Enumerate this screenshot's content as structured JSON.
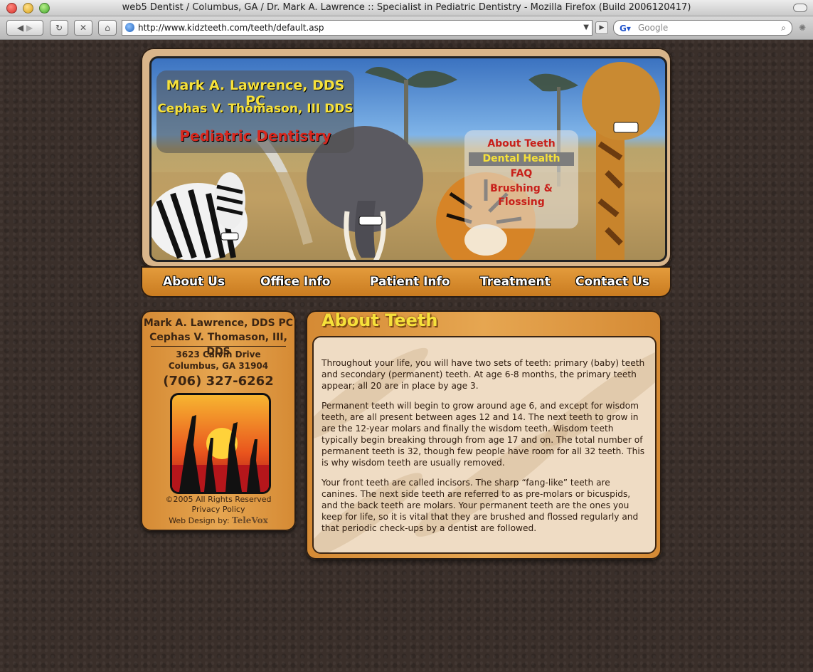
{
  "browser": {
    "window_title": "web5 Dentist / Columbus, GA / Dr. Mark A. Lawrence :: Specialist in Pediatric Dentistry - Mozilla Firefox (Build 2006120417)",
    "url": "http://www.kidzteeth.com/teeth/default.asp",
    "search_placeholder": "Google"
  },
  "header": {
    "line1": "Mark A. Lawrence, DDS PC",
    "line2": "Cephas V. Thomason, III DDS",
    "line3": "Pediatric Dentistry",
    "submenu": [
      "About Teeth",
      "Dental Health",
      "FAQ",
      "Brushing & Flossing"
    ],
    "active_submenu": "Dental Health"
  },
  "nav": {
    "items": [
      "About Us",
      "Office Info",
      "Patient Info",
      "Treatment",
      "Contact Us"
    ]
  },
  "sidebar": {
    "name1": "Mark A. Lawrence, DDS PC",
    "name2": "Cephas V. Thomason, III, DDS",
    "address1": "3623 Calvin Drive",
    "address2": "Columbus, GA 31904",
    "phone": "(706) 327-6262",
    "copyright": "©2005 All Rights Reserved",
    "privacy": "Privacy Policy",
    "web_design_label": "Web Design by:",
    "web_design_brand": "TeleVox"
  },
  "content": {
    "title": "About Teeth",
    "paragraphs": [
      "Throughout your life, you will have two sets of teeth: primary (baby) teeth and secondary (permanent) teeth. At age 6-8 months, the primary teeth appear; all 20 are in place by age 3.",
      "Permanent teeth will begin to grow around age 6, and except for wisdom teeth, are all present between ages 12 and 14. The next teeth to grow in are the 12-year molars and finally the wisdom teeth. Wisdom teeth typically begin breaking through from age 17 and on. The total number of permanent teeth is 32, though few people have room for all 32 teeth. This is why wisdom teeth are usually removed.",
      "Your front teeth are called incisors. The sharp “fang-like” teeth are canines. The next side teeth are referred to as pre-molars or bicuspids, and the back teeth are molars. Your permanent teeth are the ones you keep for life, so it is vital that they are brushed and flossed regularly and that periodic check-ups by a dentist are followed."
    ]
  }
}
